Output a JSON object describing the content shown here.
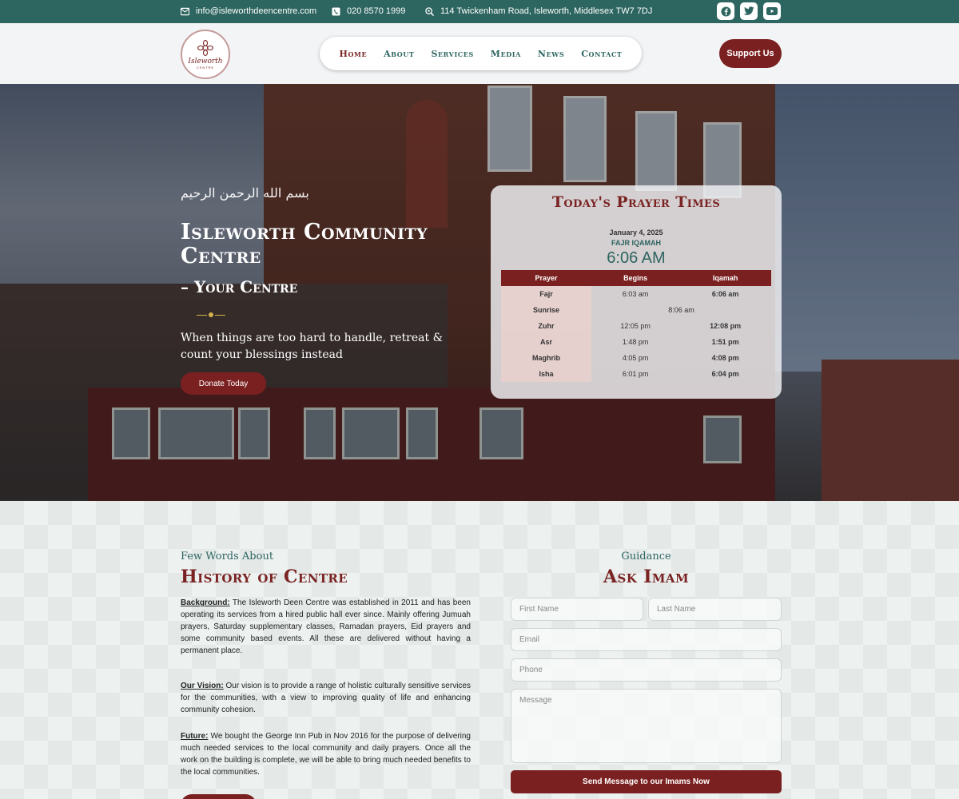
{
  "topbar": {
    "email": "info@isleworthdeencentre.com",
    "phone": "020 8570 1999",
    "address": "114 Twickenham Road, Isleworth, Middlesex TW7 7DJ",
    "social": [
      "facebook-icon",
      "twitter-icon",
      "youtube-icon"
    ]
  },
  "header": {
    "logo_text": "Isleworth",
    "logo_sub": "CENTRE",
    "nav": [
      "Home",
      "About",
      "Services",
      "Media",
      "News",
      "Contact"
    ],
    "support_label": "Support Us"
  },
  "hero": {
    "bismillah": "بسم الله الرحمن الرحيم",
    "title": "Isleworth Community Centre",
    "subtitle": "– Your Centre",
    "tagline": "When things are too hard to handle, retreat & count your blessings instead",
    "donate_label": "Donate Today"
  },
  "prayer": {
    "title": "Today's Prayer Times",
    "date": "January 4, 2025",
    "next_label": "FAJR IQAMAH",
    "next_time": "6:06 AM",
    "headers": [
      "Prayer",
      "Begins",
      "Iqamah"
    ],
    "rows": [
      {
        "name": "Fajr",
        "begins": "6:03 am",
        "iqamah": "6:06 am"
      },
      {
        "name": "Sunrise",
        "begins": "8:06 am",
        "iqamah": ""
      },
      {
        "name": "Zuhr",
        "begins": "12:05 pm",
        "iqamah": "12:08 pm"
      },
      {
        "name": "Asr",
        "begins": "1:48 pm",
        "iqamah": "1:51 pm"
      },
      {
        "name": "Maghrib",
        "begins": "4:05 pm",
        "iqamah": "4:08 pm"
      },
      {
        "name": "Isha",
        "begins": "6:01 pm",
        "iqamah": "6:04 pm"
      }
    ]
  },
  "history": {
    "kicker": "Few Words About",
    "title": "History of Centre",
    "background_label": "Background:",
    "background_text": " The Isleworth Deen Centre was established in 2011 and has been operating its services from a hired public hall ever since. Mainly offering Jumuah prayers, Saturday supplementary classes, Ramadan prayers, Eid prayers and some community based events. All these are delivered without having a permanent place.",
    "vision_label": "Our Vision:",
    "vision_text": " Our vision is to provide a range of holistic culturally sensitive services for the communities, with a view to improving quality of life and enhancing community cohesion.",
    "future_label": "Future:",
    "future_text": " We bought the George Inn Pub in Nov 2016 for the purpose of delivering much needed services to the local community and daily prayers. Once all the work on the building is complete, we will be able to bring much needed benefits to the local communities."
  },
  "imam": {
    "kicker": "Guidance",
    "title": "Ask Imam",
    "first_name": "First Name",
    "last_name": "Last Name",
    "email": "Email",
    "phone": "Phone",
    "message": "Message",
    "send_label": "Send Message to our Imams Now"
  },
  "colors": {
    "teal": "#2d6560",
    "maroon": "#7b2020"
  }
}
